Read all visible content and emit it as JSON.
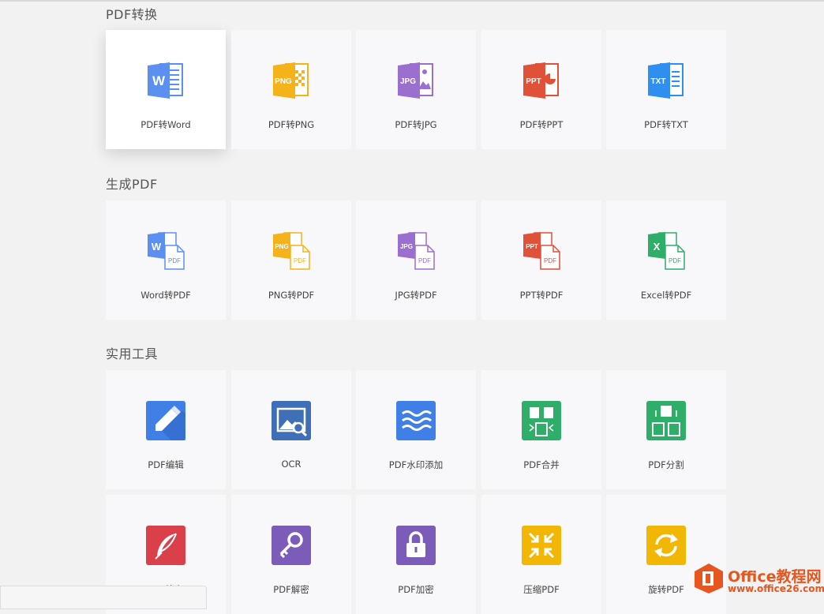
{
  "sections": [
    {
      "title": "PDF转换",
      "items": [
        {
          "label": "PDF转Word",
          "icon": "word-doc-icon"
        },
        {
          "label": "PDF转PNG",
          "icon": "png-doc-icon"
        },
        {
          "label": "PDF转JPG",
          "icon": "jpg-doc-icon"
        },
        {
          "label": "PDF转PPT",
          "icon": "ppt-doc-icon"
        },
        {
          "label": "PDF转TXT",
          "icon": "txt-doc-icon"
        }
      ]
    },
    {
      "title": "生成PDF",
      "items": [
        {
          "label": "Word转PDF",
          "icon": "word-to-pdf-icon"
        },
        {
          "label": "PNG转PDF",
          "icon": "png-to-pdf-icon"
        },
        {
          "label": "JPG转PDF",
          "icon": "jpg-to-pdf-icon"
        },
        {
          "label": "PPT转PDF",
          "icon": "ppt-to-pdf-icon"
        },
        {
          "label": "Excel转PDF",
          "icon": "excel-to-pdf-icon"
        }
      ]
    },
    {
      "title": "实用工具",
      "items": [
        {
          "label": "PDF编辑",
          "icon": "pencil-icon"
        },
        {
          "label": "OCR",
          "icon": "ocr-icon"
        },
        {
          "label": "PDF水印添加",
          "icon": "watermark-icon"
        },
        {
          "label": "PDF合并",
          "icon": "merge-icon"
        },
        {
          "label": "PDF分割",
          "icon": "split-icon"
        },
        {
          "label": "PDF签名",
          "icon": "feather-icon"
        },
        {
          "label": "PDF解密",
          "icon": "key-icon"
        },
        {
          "label": "PDF加密",
          "icon": "lock-icon"
        },
        {
          "label": "压缩PDF",
          "icon": "compress-icon"
        },
        {
          "label": "旋转PDF",
          "icon": "rotate-icon"
        }
      ]
    }
  ],
  "colors": {
    "word": "#5b8ff0",
    "png": "#f4b21b",
    "jpg": "#9b6fcf",
    "ppt": "#e0513a",
    "txt": "#2f8ff0",
    "excel": "#2fae6a",
    "edit": "#3f7fe6",
    "ocr": "#3f6fb7",
    "watermark": "#3f7fe6",
    "merge": "#2fae6a",
    "split": "#2fae6a",
    "sign": "#d9404a",
    "decrypt": "#7b5cb8",
    "encrypt": "#7b5cb8",
    "compress": "#f2b705",
    "rotate": "#f2b705"
  },
  "watermark": {
    "line1": "Office教程网",
    "line2": "www.office26.com"
  }
}
